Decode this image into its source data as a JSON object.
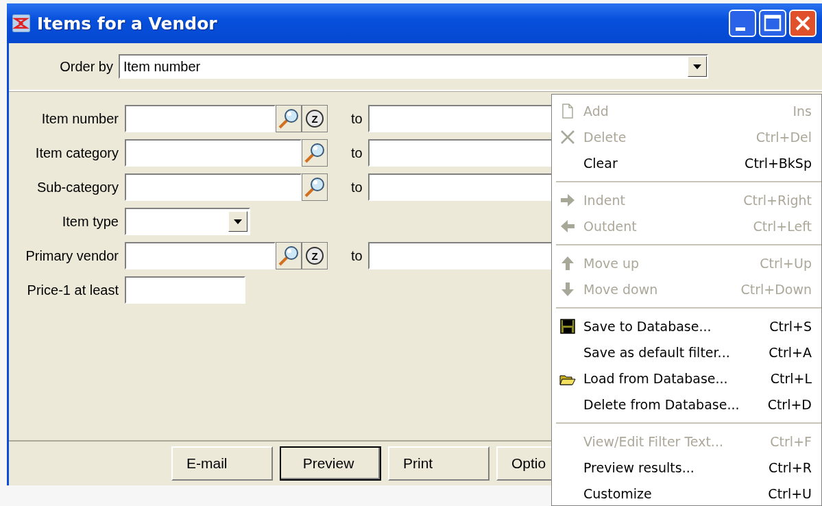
{
  "window": {
    "title": "Items for a Vendor"
  },
  "order_by": {
    "label": "Order by",
    "value": "Item number"
  },
  "fields": [
    {
      "kind": "range",
      "label": "Item number",
      "lookups": [
        {
          "kind": "search"
        },
        {
          "kind": "zoom",
          "label": "Z"
        }
      ],
      "to_label": "to"
    },
    {
      "kind": "range",
      "label": "Item category",
      "lookups": [
        {
          "kind": "search"
        }
      ],
      "to_label": "to"
    },
    {
      "kind": "range",
      "label": "Sub-category",
      "lookups": [
        {
          "kind": "search"
        }
      ],
      "to_label": "to"
    },
    {
      "kind": "dropdown",
      "label": "Item type"
    },
    {
      "kind": "range",
      "label": "Primary vendor",
      "lookups": [
        {
          "kind": "search"
        },
        {
          "kind": "zoom",
          "label": "Z"
        }
      ],
      "to_label": "to"
    },
    {
      "kind": "text",
      "label": "Price-1 at least"
    }
  ],
  "buttons": [
    {
      "label": "E-mail",
      "default": false
    },
    {
      "label": "Preview",
      "default": true
    },
    {
      "label": "Print",
      "default": false
    },
    {
      "label": "Optio",
      "default": false
    }
  ],
  "context_menu": [
    {
      "kind": "item",
      "label": "Add",
      "shortcut": "Ins",
      "disabled": true
    },
    {
      "kind": "item",
      "label": "Delete",
      "shortcut": "Ctrl+Del",
      "disabled": true
    },
    {
      "kind": "item",
      "label": "Clear",
      "shortcut": "Ctrl+BkSp",
      "disabled": false
    },
    {
      "kind": "separator"
    },
    {
      "kind": "item",
      "label": "Indent",
      "shortcut": "Ctrl+Right",
      "disabled": true
    },
    {
      "kind": "item",
      "label": "Outdent",
      "shortcut": "Ctrl+Left",
      "disabled": true
    },
    {
      "kind": "separator"
    },
    {
      "kind": "item",
      "label": "Move up",
      "shortcut": "Ctrl+Up",
      "disabled": true
    },
    {
      "kind": "item",
      "label": "Move down",
      "shortcut": "Ctrl+Down",
      "disabled": true
    },
    {
      "kind": "separator"
    },
    {
      "kind": "item",
      "label": "Save to Database...",
      "shortcut": "Ctrl+S",
      "disabled": false
    },
    {
      "kind": "item",
      "label": "Save as default filter...",
      "shortcut": "Ctrl+A",
      "disabled": false
    },
    {
      "kind": "item",
      "label": "Load from Database...",
      "shortcut": "Ctrl+L",
      "disabled": false
    },
    {
      "kind": "item",
      "label": "Delete from Database...",
      "shortcut": "Ctrl+D",
      "disabled": false
    },
    {
      "kind": "separator"
    },
    {
      "kind": "item",
      "label": "View/Edit Filter Text...",
      "shortcut": "Ctrl+F",
      "disabled": true
    },
    {
      "kind": "item",
      "label": "Preview results...",
      "shortcut": "Ctrl+R",
      "disabled": false
    },
    {
      "kind": "item",
      "label": "Customize",
      "shortcut": "Ctrl+U",
      "disabled": false
    }
  ]
}
